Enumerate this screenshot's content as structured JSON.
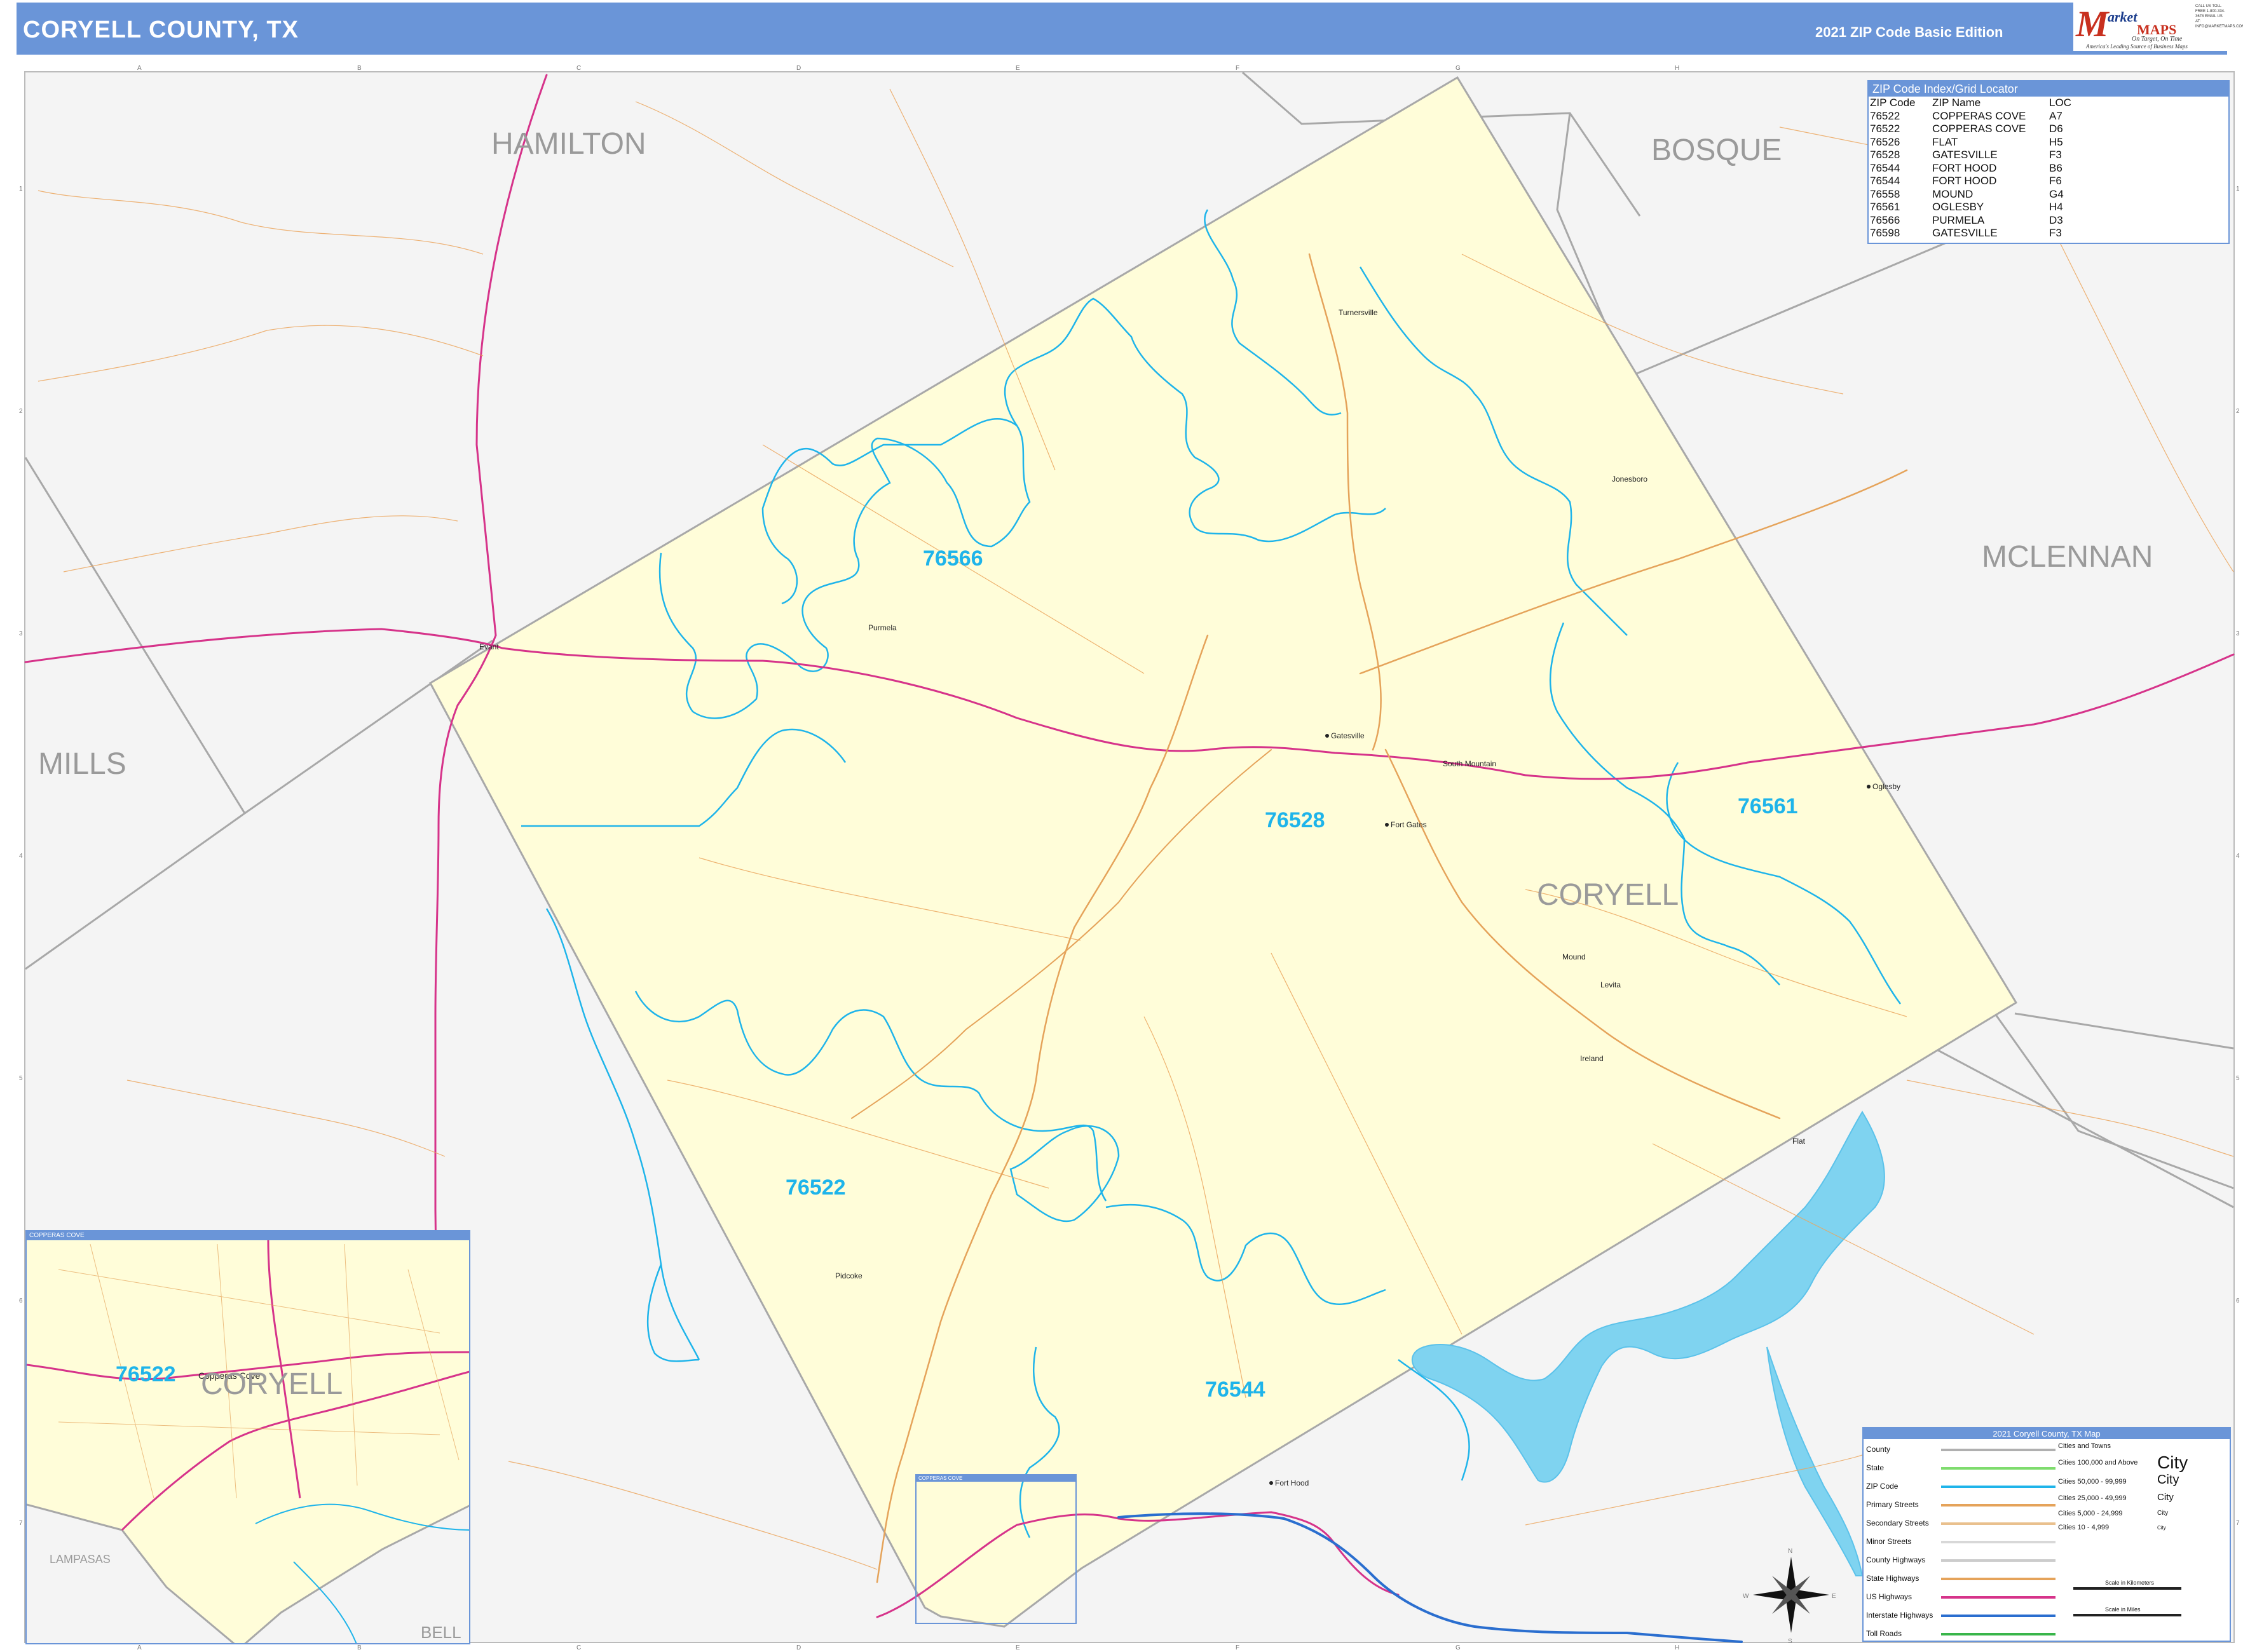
{
  "header": {
    "title": "CORYELL COUNTY, TX",
    "edition": "2021 ZIP Code Basic Edition"
  },
  "logo": {
    "letter": "M",
    "word1": "arket",
    "word2": "MAPS",
    "tagline": "On Target, On Time",
    "subtag": "America's Leading Source of Business Maps",
    "contact": "CALL US TOLL FREE 1-800-334-3678 EMAIL US AT: INFO@MARKETMAPS.COM"
  },
  "counties": {
    "hamilton": "HAMILTON",
    "bosque": "BOSQUE",
    "mclennan": "MCLENNAN",
    "mills": "MILLS",
    "coryell": "CORYELL",
    "lampasas": "LAMPASAS",
    "bell": "BELL"
  },
  "zips": {
    "z76566": "76566",
    "z76528": "76528",
    "z76561": "76561",
    "z76522": "76522",
    "z76544": "76544",
    "inset_zip": "76522"
  },
  "places": {
    "gatesville": "Gatesville",
    "fort_gates": "Fort Gates",
    "oglesby": "Oglesby",
    "fort_hood": "Fort Hood",
    "copperas_cove": "Copperas Cove",
    "south_mountain": "South Mountain",
    "evant": "Evant",
    "purmela": "Purmela",
    "mound": "Mound",
    "jonesboro": "Jonesboro",
    "turnersville": "Turnersville",
    "levita": "Levita",
    "ireland": "Ireland",
    "pidcoke": "Pidcoke",
    "flat": "Flat"
  },
  "grid": {
    "columns": [
      "A",
      "B",
      "C",
      "D",
      "E",
      "F",
      "G",
      "H"
    ],
    "rows": [
      "1",
      "2",
      "3",
      "4",
      "5",
      "6",
      "7"
    ]
  },
  "zip_index": {
    "title": "ZIP Code Index/Grid Locator",
    "headers": [
      "ZIP Code",
      "ZIP Name",
      "LOC"
    ],
    "rows": [
      [
        "76522",
        "COPPERAS COVE",
        "A7"
      ],
      [
        "76522",
        "COPPERAS COVE",
        "D6"
      ],
      [
        "76526",
        "FLAT",
        "H5"
      ],
      [
        "76528",
        "GATESVILLE",
        "F3"
      ],
      [
        "76544",
        "FORT HOOD",
        "B6"
      ],
      [
        "76544",
        "FORT HOOD",
        "F6"
      ],
      [
        "76558",
        "MOUND",
        "G4"
      ],
      [
        "76561",
        "OGLESBY",
        "H4"
      ],
      [
        "76566",
        "PURMELA",
        "D3"
      ],
      [
        "76598",
        "GATESVILLE",
        "F3"
      ]
    ]
  },
  "inset": {
    "title": "COPPERAS COVE",
    "box_title": "COPPERAS COVE",
    "coryell": "CORYELL",
    "city": "Copperas Cove"
  },
  "legend": {
    "title": "2021 Coryell County, TX Map",
    "items": [
      "County",
      "State",
      "ZIP Code",
      "Primary Streets",
      "Secondary Streets",
      "Minor Streets",
      "County Highways",
      "State Highways",
      "US Highways",
      "Interstate Highways",
      "Toll Roads"
    ],
    "colors": [
      "#b0b0b0",
      "#7fdc6e",
      "#1eb4ea",
      "#e5a35a",
      "#e9c08e",
      "#d8d8d8",
      "#cccccc",
      "#e5a35a",
      "#d6338a",
      "#2a6ecf",
      "#39b54a"
    ],
    "cities_header": "Cities and Towns",
    "city_sizes": [
      "Cities 100,000 and Above",
      "Cities 50,000 - 99,999",
      "Cities 25,000 - 49,999",
      "Cities 5,000 - 24,999",
      "Cities 10 - 4,999"
    ],
    "city_examples": [
      "City",
      "City",
      "City",
      "City",
      "City"
    ],
    "scale_km": "Scale in Kilometers",
    "scale_mi": "Scale in Miles",
    "compass": [
      "N",
      "E",
      "S",
      "W"
    ]
  }
}
